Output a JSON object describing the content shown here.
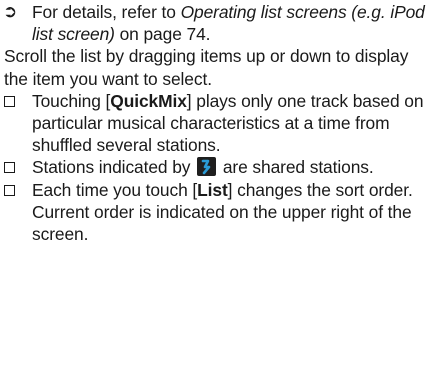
{
  "reference": {
    "marker_icon": "arrow-right-icon",
    "prefix": "For details, refer to ",
    "link_text": "Operating list screens (e.g. iPod list screen)",
    "suffix": " on page 74."
  },
  "intro": {
    "text": "Scroll the list by dragging items up or down to display the item you want to select."
  },
  "notes": [
    {
      "marker_icon": "checkbox-bullet-icon",
      "before": "Touching [",
      "key": "QuickMix",
      "after": "] plays only one track based on particular musical characteristics at a time from shuffled several stations."
    },
    {
      "marker_icon": "checkbox-bullet-icon",
      "before": "Stations indicated by ",
      "icon": "shared-station-icon",
      "after": " are shared stations."
    },
    {
      "marker_icon": "checkbox-bullet-icon",
      "before": "Each time you touch [",
      "key": "List",
      "after": "] changes the sort order.",
      "extra": "Current order is indicated on the upper right of the screen."
    }
  ],
  "colors": {
    "text": "#1a1a1a",
    "icon_bg": "#1f1f1f",
    "icon_accent": "#2a9bd6"
  }
}
